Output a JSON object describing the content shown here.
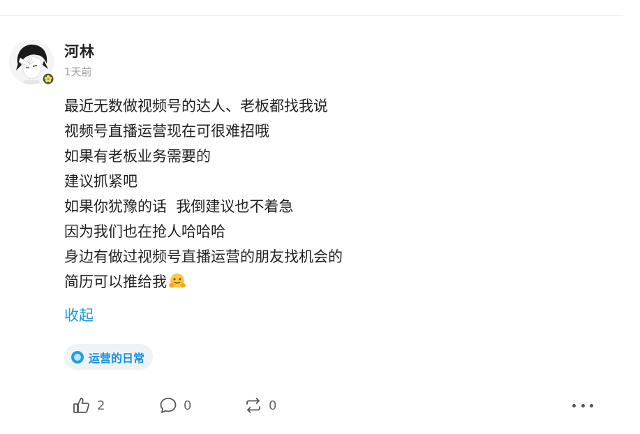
{
  "post": {
    "author": "河林",
    "time": "1天前",
    "content_lines": [
      "最近无数做视频号的达人、老板都找我说",
      "视频号直播运营现在可很难招哦",
      "如果有老板业务需要的",
      "建议抓紧吧",
      "如果你犹豫的话  我倒建议也不着急",
      "因为我们也在抢人哈哈哈",
      "身边有做过视频号直播运营的朋友找机会的",
      "简历可以推给我"
    ],
    "last_line_emoji": "hugging-face-emoji",
    "collapse_label": "收起",
    "topic_tag": "运营的日常"
  },
  "actions": {
    "like_count": "2",
    "comment_count": "0",
    "repost_count": "0",
    "like_icon": "thumbs-up-icon",
    "comment_icon": "comment-bubble-icon",
    "repost_icon": "repost-arrows-icon",
    "more_icon": "more-dots-icon"
  },
  "colors": {
    "link_blue": "#1a9be6",
    "tag_bg": "#eef3f8",
    "tag_text": "#1a8fd6",
    "secondary_text": "#a0a0a0"
  }
}
